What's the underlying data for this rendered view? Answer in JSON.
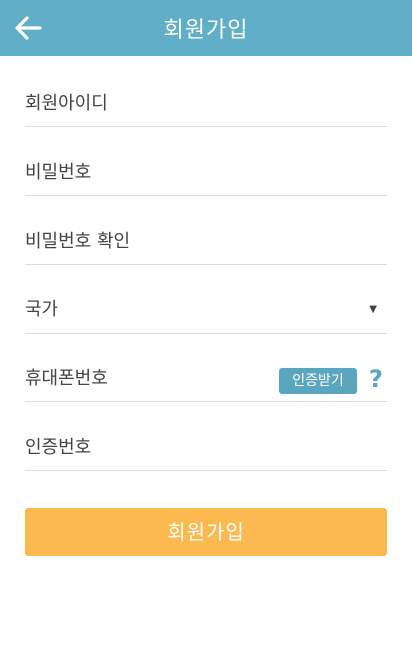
{
  "header": {
    "back_icon": "arrow-left-icon",
    "title": "회원가입"
  },
  "form": {
    "user_id_placeholder": "회원아이디",
    "password_placeholder": "비밀번호",
    "password_confirm_placeholder": "비밀번호 확인",
    "country_value": "국가",
    "caret_icon": "▼",
    "phone_placeholder": "휴대폰번호",
    "verify_button_label": "인증받기",
    "help_icon": "?",
    "verification_code_placeholder": "인증번호"
  },
  "submit": {
    "label": "회원가입"
  },
  "colors": {
    "header_bg": "#60aec7",
    "accent": "#5aa6bf",
    "submit_bg": "#fbb94f"
  }
}
